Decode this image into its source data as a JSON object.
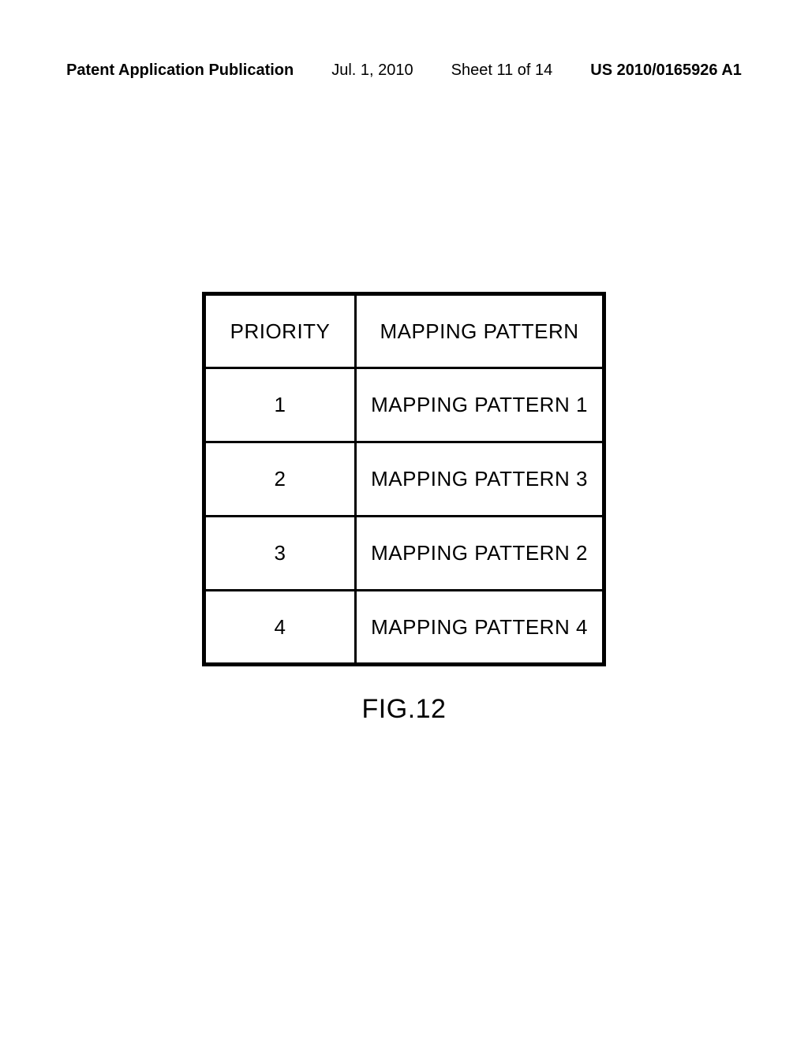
{
  "header": {
    "left": "Patent Application Publication",
    "date": "Jul. 1, 2010",
    "sheet": "Sheet 11 of 14",
    "pubnum": "US 2010/0165926 A1"
  },
  "table": {
    "headers": {
      "priority": "PRIORITY",
      "pattern": "MAPPING PATTERN"
    },
    "rows": [
      {
        "priority": "1",
        "pattern": "MAPPING PATTERN 1"
      },
      {
        "priority": "2",
        "pattern": "MAPPING PATTERN 3"
      },
      {
        "priority": "3",
        "pattern": "MAPPING PATTERN 2"
      },
      {
        "priority": "4",
        "pattern": "MAPPING PATTERN 4"
      }
    ]
  },
  "figure": {
    "caption": "FIG.12"
  }
}
